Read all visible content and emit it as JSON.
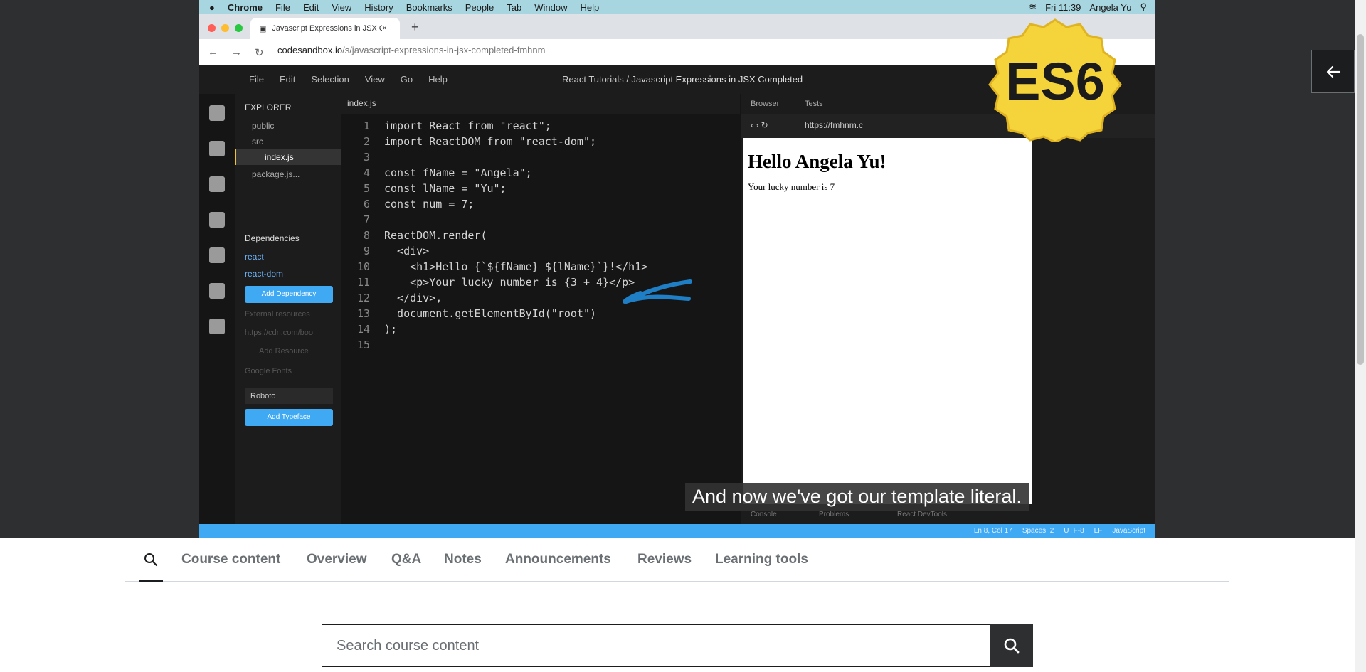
{
  "video": {
    "mac_menubar": {
      "app": "Chrome",
      "items": [
        "File",
        "Edit",
        "View",
        "History",
        "Bookmarks",
        "People",
        "Tab",
        "Window",
        "Help"
      ],
      "clock": "Fri 11:39",
      "user": "Angela Yu"
    },
    "browser": {
      "tab_title": "Javascript Expressions in JSX C",
      "url_host": "codesandbox.io",
      "url_path": "/s/javascript-expressions-in-jsx-completed-fmhnm"
    },
    "codesandbox": {
      "menu": [
        "File",
        "Edit",
        "Selection",
        "View",
        "Go",
        "Help"
      ],
      "title_prefix": "React Tutorials / ",
      "title": "Javascript Expressions in JSX Completed",
      "explorer_label": "EXPLORER",
      "folders": [
        "public",
        "src"
      ],
      "active_file": "index.js",
      "other_file": "package.js...",
      "dependencies_label": "Dependencies",
      "dependencies": [
        "react",
        "react-dom"
      ],
      "add_dependency": "Add Dependency",
      "external_resources": "External resources",
      "resource_placeholder": "https://cdn.com/boo",
      "add_resource": "Add Resource",
      "google_fonts": "Google Fonts",
      "font_selected": "Roboto",
      "add_typeface": "Add Typeface",
      "editor_tab": "index.js",
      "code_lines": [
        "import React from \"react\";",
        "import ReactDOM from \"react-dom\";",
        "",
        "const fName = \"Angela\";",
        "const lName = \"Yu\";",
        "const num = 7;",
        "",
        "ReactDOM.render(",
        "  <div>",
        "    <h1>Hello {`${fName} ${lName}`}!</h1>",
        "    <p>Your lucky number is {3 + 4}</p>",
        "  </div>,",
        "  document.getElementById(\"root\")",
        ");",
        ""
      ],
      "preview_tabs": [
        "Browser",
        "Tests"
      ],
      "preview_url": "https://fmhnm.c",
      "preview_heading": "Hello Angela Yu!",
      "preview_text": "Your lucky number is 7",
      "console_tabs": [
        "Console",
        "Problems",
        "React DevTools"
      ],
      "status": [
        "Ln 8, Col 17",
        "Spaces: 2",
        "UTF-8",
        "LF",
        "JavaScript"
      ]
    },
    "badge": "ES6",
    "caption": "And now we've got our template literal."
  },
  "course_tabs": [
    "Course content",
    "Overview",
    "Q&A",
    "Notes",
    "Announcements",
    "Reviews",
    "Learning tools"
  ],
  "search": {
    "placeholder": "Search course content"
  },
  "colors": {
    "accent_blue": "#40a9f3",
    "badge_yellow": "#f5d33a",
    "doodle_blue": "#1e7fc6"
  }
}
